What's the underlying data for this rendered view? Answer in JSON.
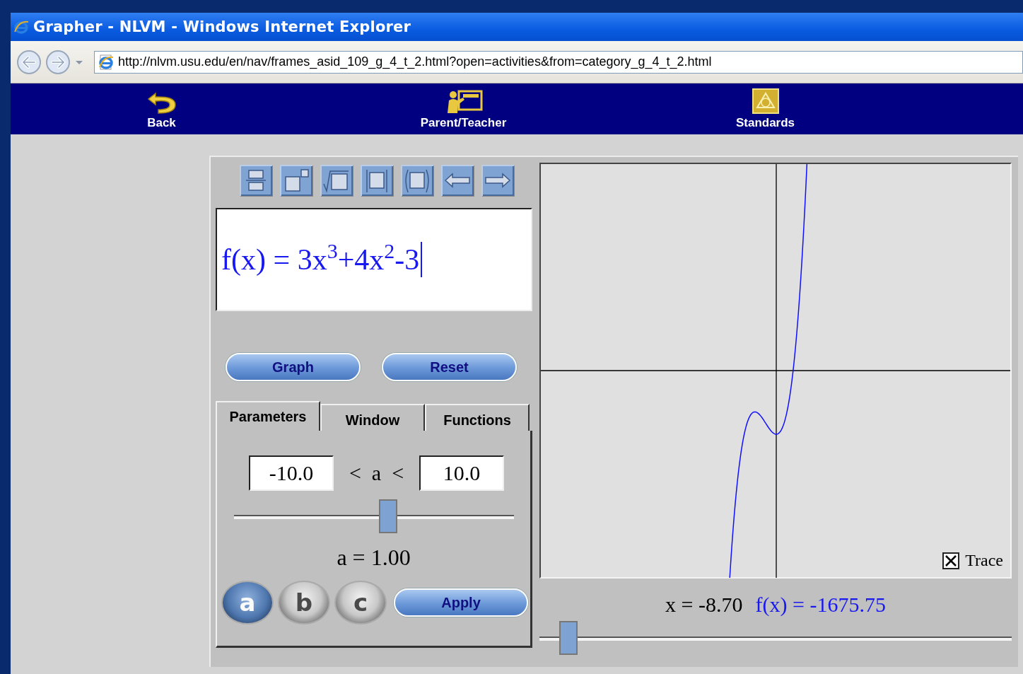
{
  "window": {
    "title": "Grapher - NLVM - Windows Internet Explorer"
  },
  "address_bar": {
    "url": "http://nlvm.usu.edu/en/nav/frames_asid_109_g_4_t_2.html?open=activities&from=category_g_4_t_2.html"
  },
  "nav": {
    "items": [
      {
        "label": "Back"
      },
      {
        "label": "Parent/Teacher"
      },
      {
        "label": "Standards"
      }
    ]
  },
  "expression": "f(x) = 3x$^{3}$+4x$^{2}$-3",
  "buttons": [
    "Graph",
    "Reset"
  ],
  "tabs": [
    {
      "label": "Parameters",
      "selected": true
    },
    {
      "label": "Window",
      "selected": false
    },
    {
      "label": "Functions",
      "selected": false
    }
  ],
  "parameter": {
    "min": "-10.0",
    "relation": "<  a  <",
    "max": "10.0",
    "level": 0.55,
    "reading": "a = 1.00"
  },
  "parameter_buttons": [
    {
      "label": "a",
      "selected": true
    },
    {
      "label": "b",
      "selected": false
    },
    {
      "label": "c",
      "selected": false
    }
  ],
  "apply": "Apply",
  "trace": {
    "label": "Trace",
    "checked": true,
    "x_reading": "x = -8.70",
    "fx_reading": "f(x) = -1675.75",
    "level": 0.06
  }
}
